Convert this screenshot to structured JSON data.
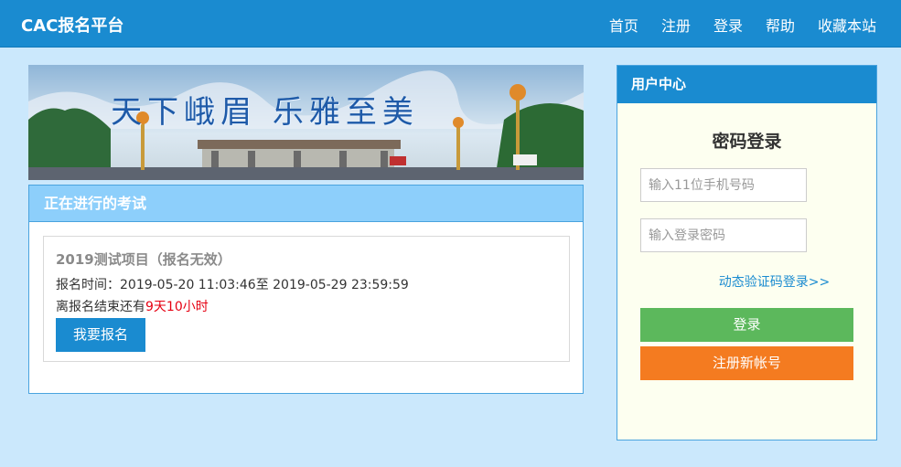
{
  "header": {
    "brand": "CAC报名平台",
    "nav": [
      "首页",
      "注册",
      "登录",
      "帮助",
      "收藏本站"
    ]
  },
  "banner": {
    "slogan": "天下峨眉 乐雅至美"
  },
  "exam_panel": {
    "title": "正在进行的考试",
    "exam": {
      "name": "2019测试项目（报名无效）",
      "time_label": "报名时间：",
      "time_range": "2019-05-20 11:03:46至 2019-05-29 23:59:59",
      "remain_label": "离报名结束还有",
      "remain_value": "9天10小时",
      "apply_label": "我要报名"
    }
  },
  "user_panel": {
    "title": "用户中心",
    "login_title": "密码登录",
    "phone_placeholder": "输入11位手机号码",
    "password_placeholder": "输入登录密码",
    "dynamic_link": "动态验证码登录>>",
    "login_label": "登录",
    "register_label": "注册新帐号"
  },
  "colors": {
    "primary": "#1a8bd0",
    "page_bg": "#cbe8fc",
    "panel_head": "#8dcffb",
    "login_green": "#5cb85c",
    "register_orange": "#f47b20",
    "remain_red": "#e60012"
  }
}
